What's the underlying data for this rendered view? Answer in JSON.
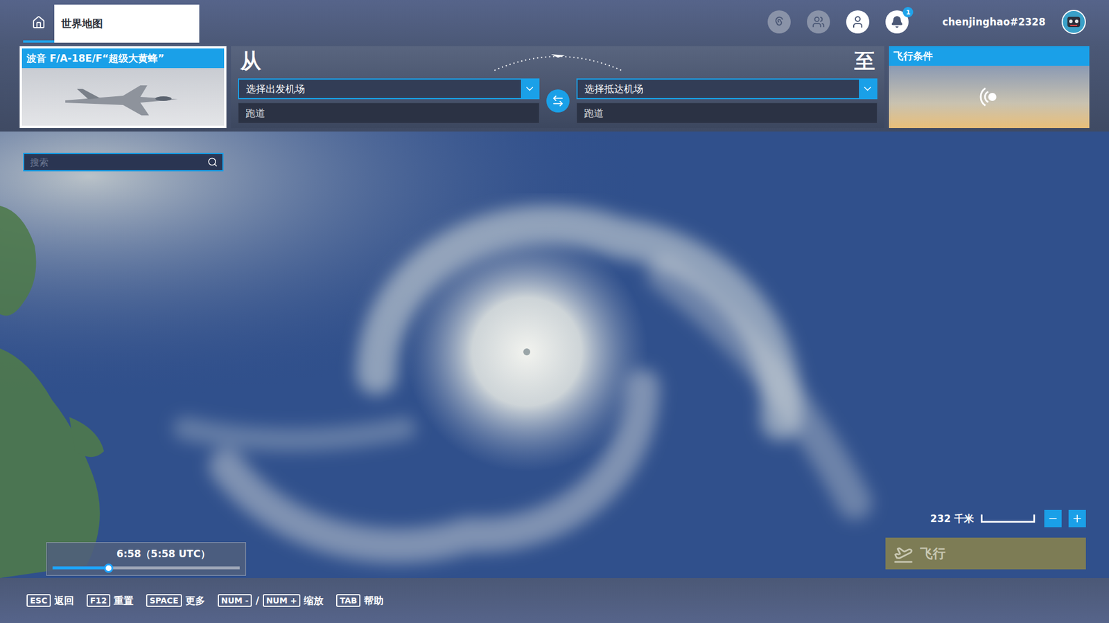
{
  "top_bar": {
    "tabs": [
      {
        "label": "世界地图",
        "selected": true
      }
    ],
    "notifications": {
      "badge": "1"
    },
    "user": {
      "name": "chenjinghao#2328"
    }
  },
  "aircraft": {
    "title": "波音 F/A-18E/F“超级大黄蜂”"
  },
  "route": {
    "from_label": "从",
    "to_label": "至",
    "departure": {
      "placeholder": "选择出发机场",
      "runway": "跑道"
    },
    "arrival": {
      "placeholder": "选择抵达机场",
      "runway": "跑道"
    }
  },
  "conditions": {
    "title": "飞行条件"
  },
  "search": {
    "placeholder": "搜索"
  },
  "time": {
    "reading": "6:58（5:58 UTC）",
    "level": 0.3
  },
  "scale": {
    "reading": "232 千米"
  },
  "fly_button": {
    "label": "飞行",
    "disabled": true
  },
  "shortcuts": [
    {
      "keys": [
        "ESC"
      ],
      "label": "返回"
    },
    {
      "keys": [
        "F12"
      ],
      "label": "重置"
    },
    {
      "keys": [
        "SPACE"
      ],
      "label": "更多"
    },
    {
      "keys": [
        "NUM -",
        "NUM +"
      ],
      "separator": "/",
      "label": "缩放"
    },
    {
      "keys": [
        "TAB"
      ],
      "label": "帮助"
    }
  ]
}
